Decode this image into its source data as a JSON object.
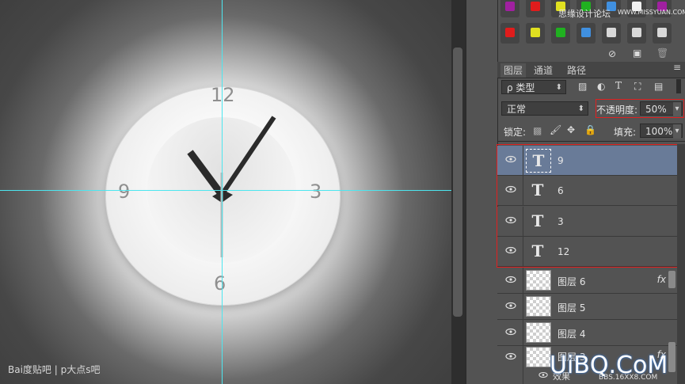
{
  "canvas": {
    "clock_numbers": {
      "n12": "12",
      "n3": "3",
      "n6": "6",
      "n9": "9"
    },
    "watermark": "Bai度贴吧 | p大点s吧"
  },
  "top_watermark": {
    "cn": "思缘设计论坛",
    "url": "WWW.MISSYUAN.COM"
  },
  "styles": {
    "swatches_row1": [
      "#a020a0",
      "#e01c1c",
      "#e0e020",
      "#20b020",
      "#4090e0",
      "#f0f0f0",
      "#a020a0"
    ],
    "swatches_row2": [
      "#e01c1c",
      "#e0e020",
      "#20b020",
      "#4090e0",
      "#e0e0e0",
      "#e0e0e0",
      "#e0e0e0"
    ]
  },
  "tabs": [
    "图层",
    "通道",
    "路径"
  ],
  "filter": {
    "kind_label": "ρ 类型"
  },
  "blend": {
    "mode": "正常",
    "opacity_label": "不透明度:",
    "opacity_value": "50%"
  },
  "lock": {
    "label": "锁定:"
  },
  "fill": {
    "label": "填充:",
    "value": "100%"
  },
  "layers": [
    {
      "name": "9",
      "type": "text",
      "selected": true
    },
    {
      "name": "6",
      "type": "text"
    },
    {
      "name": "3",
      "type": "text"
    },
    {
      "name": "12",
      "type": "text"
    },
    {
      "name": "图层 6",
      "type": "pixel",
      "fx": "fx"
    },
    {
      "name": "图层 5",
      "type": "pixel"
    },
    {
      "name": "图层 4",
      "type": "pixel"
    },
    {
      "name": "图层 3",
      "type": "pixel",
      "fx": "fx"
    }
  ],
  "sub_effects": {
    "label": "效果"
  },
  "bottom_watermark": {
    "brand": "UiBQ.CoM",
    "sub": "BBS.16XX8.COM"
  },
  "icons": [
    "eye-icon",
    "no-icon",
    "new-style-icon",
    "trash-icon",
    "image-filter-icon",
    "adjust-filter-icon",
    "type-filter-icon",
    "shape-filter-icon",
    "smart-filter-icon",
    "lock-transparent-icon",
    "lock-brush-icon",
    "lock-move-icon",
    "lock-all-icon"
  ]
}
